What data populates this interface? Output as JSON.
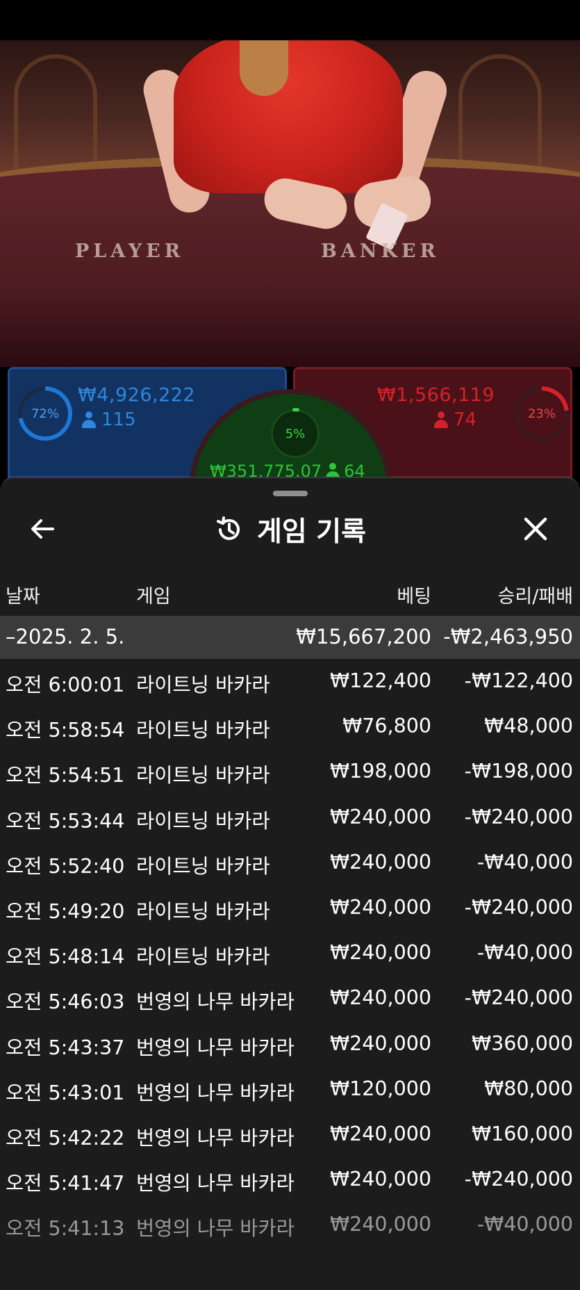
{
  "video": {
    "felt_left": "PLAYER",
    "felt_right": "BANKER"
  },
  "stats": {
    "player": {
      "percent": "72%",
      "percent_value": 72,
      "amount": "₩4,926,222",
      "players": "115",
      "color": "#1e78d6"
    },
    "banker": {
      "percent": "23%",
      "percent_value": 23,
      "amount": "₩1,566,119",
      "players": "74",
      "color": "#d8202a"
    },
    "tie": {
      "percent": "5%",
      "percent_value": 5,
      "amount": "₩351,775.07",
      "players": "64",
      "color": "#2fc43b"
    }
  },
  "history": {
    "title": "게임 기록",
    "columns": {
      "date": "날짜",
      "game": "게임",
      "bet": "베팅",
      "result": "승리/패배"
    },
    "summary": {
      "date": "–2025. 2. 5.",
      "bet": "₩15,667,200",
      "result": "-₩2,463,950"
    },
    "rows": [
      {
        "time": "오전 6:00:01",
        "game": "라이트닝 바카라",
        "bet": "₩122,400",
        "result": "-₩122,400"
      },
      {
        "time": "오전 5:58:54",
        "game": "라이트닝 바카라",
        "bet": "₩76,800",
        "result": "₩48,000"
      },
      {
        "time": "오전 5:54:51",
        "game": "라이트닝 바카라",
        "bet": "₩198,000",
        "result": "-₩198,000"
      },
      {
        "time": "오전 5:53:44",
        "game": "라이트닝 바카라",
        "bet": "₩240,000",
        "result": "-₩240,000"
      },
      {
        "time": "오전 5:52:40",
        "game": "라이트닝 바카라",
        "bet": "₩240,000",
        "result": "-₩40,000"
      },
      {
        "time": "오전 5:49:20",
        "game": "라이트닝 바카라",
        "bet": "₩240,000",
        "result": "-₩240,000"
      },
      {
        "time": "오전 5:48:14",
        "game": "라이트닝 바카라",
        "bet": "₩240,000",
        "result": "-₩40,000"
      },
      {
        "time": "오전 5:46:03",
        "game": "번영의 나무 바카라",
        "bet": "₩240,000",
        "result": "-₩240,000"
      },
      {
        "time": "오전 5:43:37",
        "game": "번영의 나무 바카라",
        "bet": "₩240,000",
        "result": "₩360,000"
      },
      {
        "time": "오전 5:43:01",
        "game": "번영의 나무 바카라",
        "bet": "₩120,000",
        "result": "₩80,000"
      },
      {
        "time": "오전 5:42:22",
        "game": "번영의 나무 바카라",
        "bet": "₩240,000",
        "result": "₩160,000"
      },
      {
        "time": "오전 5:41:47",
        "game": "번영의 나무 바카라",
        "bet": "₩240,000",
        "result": "-₩240,000"
      },
      {
        "time": "오전 5:41:13",
        "game": "번영의 나무 바카라",
        "bet": "₩240,000",
        "result": "-₩40,000"
      }
    ]
  },
  "icons": {
    "back": "arrow-left-icon",
    "close": "close-icon",
    "history": "history-clock-icon",
    "person": "person-icon"
  }
}
